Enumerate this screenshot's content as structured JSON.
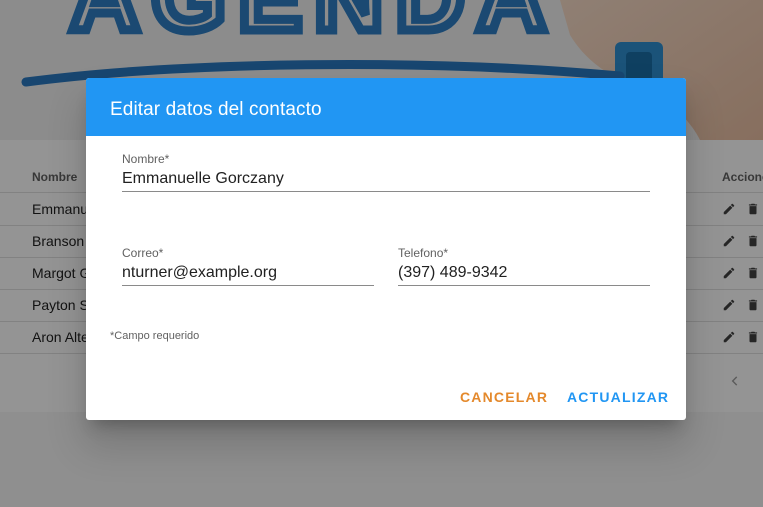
{
  "banner": {
    "heading": "AGENDA"
  },
  "table": {
    "headers": {
      "name": "Nombre",
      "actions": "Acciones"
    },
    "rows": [
      {
        "name": "Emmanu"
      },
      {
        "name": "Branson"
      },
      {
        "name": "Margot G"
      },
      {
        "name": "Payton S"
      },
      {
        "name": "Aron Alte"
      }
    ]
  },
  "dialog": {
    "title": "Editar datos del contacto",
    "fields": {
      "name": {
        "label": "Nombre*",
        "value": "Emmanuelle Gorczany"
      },
      "email": {
        "label": "Correo*",
        "value": "nturner@example.org"
      },
      "phone": {
        "label": "Telefono*",
        "value": "(397) 489-9342"
      }
    },
    "required_note": "*Campo requerido",
    "buttons": {
      "cancel": "CANCELAR",
      "update": "ACTUALIZAR"
    }
  },
  "colors": {
    "primary": "#2196f3",
    "accent": "#e4892c"
  },
  "icons": {
    "edit": "pencil-icon",
    "delete": "trash-icon",
    "prev_page": "chevron-left-icon"
  }
}
